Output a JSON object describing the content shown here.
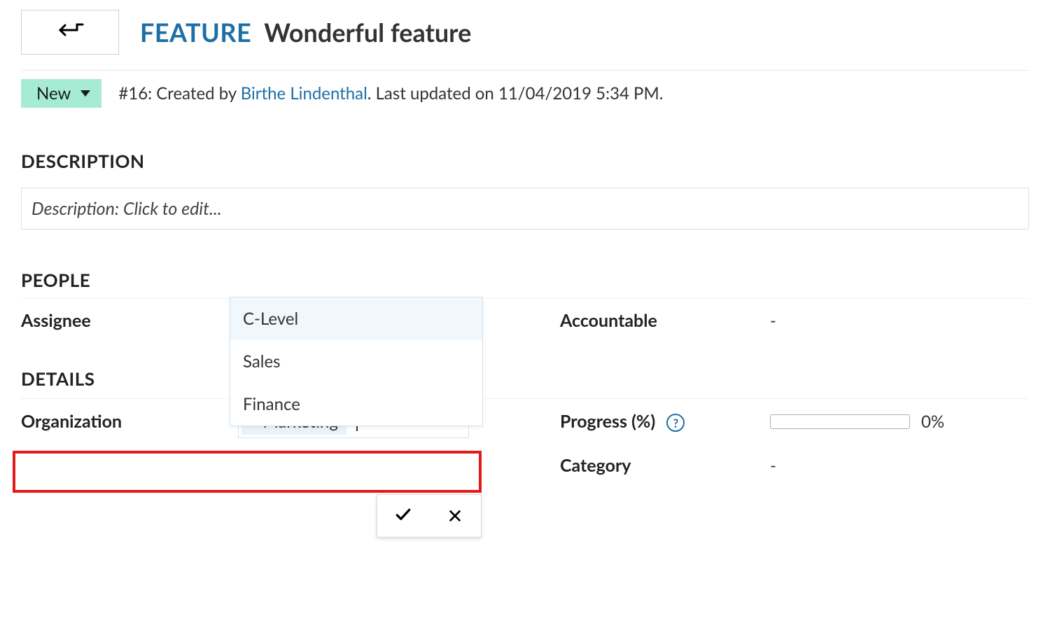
{
  "header": {
    "type_label": "FEATURE",
    "title": "Wonderful feature"
  },
  "status": {
    "value": "New"
  },
  "meta": {
    "id_prefix": "#16: Created by ",
    "author": "Birthe Lindenthal",
    "suffix": ". Last updated on 11/04/2019 5:34 PM."
  },
  "sections": {
    "description_heading": "DESCRIPTION",
    "people_heading": "PEOPLE",
    "details_heading": "DETAILS"
  },
  "description": {
    "placeholder": "Description: Click to edit..."
  },
  "people": {
    "assignee_label": "Assignee",
    "accountable_label": "Accountable",
    "accountable_value": "-"
  },
  "details": {
    "organization_label": "Organization",
    "progress_label": "Progress (%)",
    "progress_value": "0%",
    "category_label": "Category",
    "category_value": "-"
  },
  "organization_editor": {
    "selected_tag": "Marketing",
    "options": [
      "C-Level",
      "Sales",
      "Finance"
    ]
  },
  "help_glyph": "?"
}
